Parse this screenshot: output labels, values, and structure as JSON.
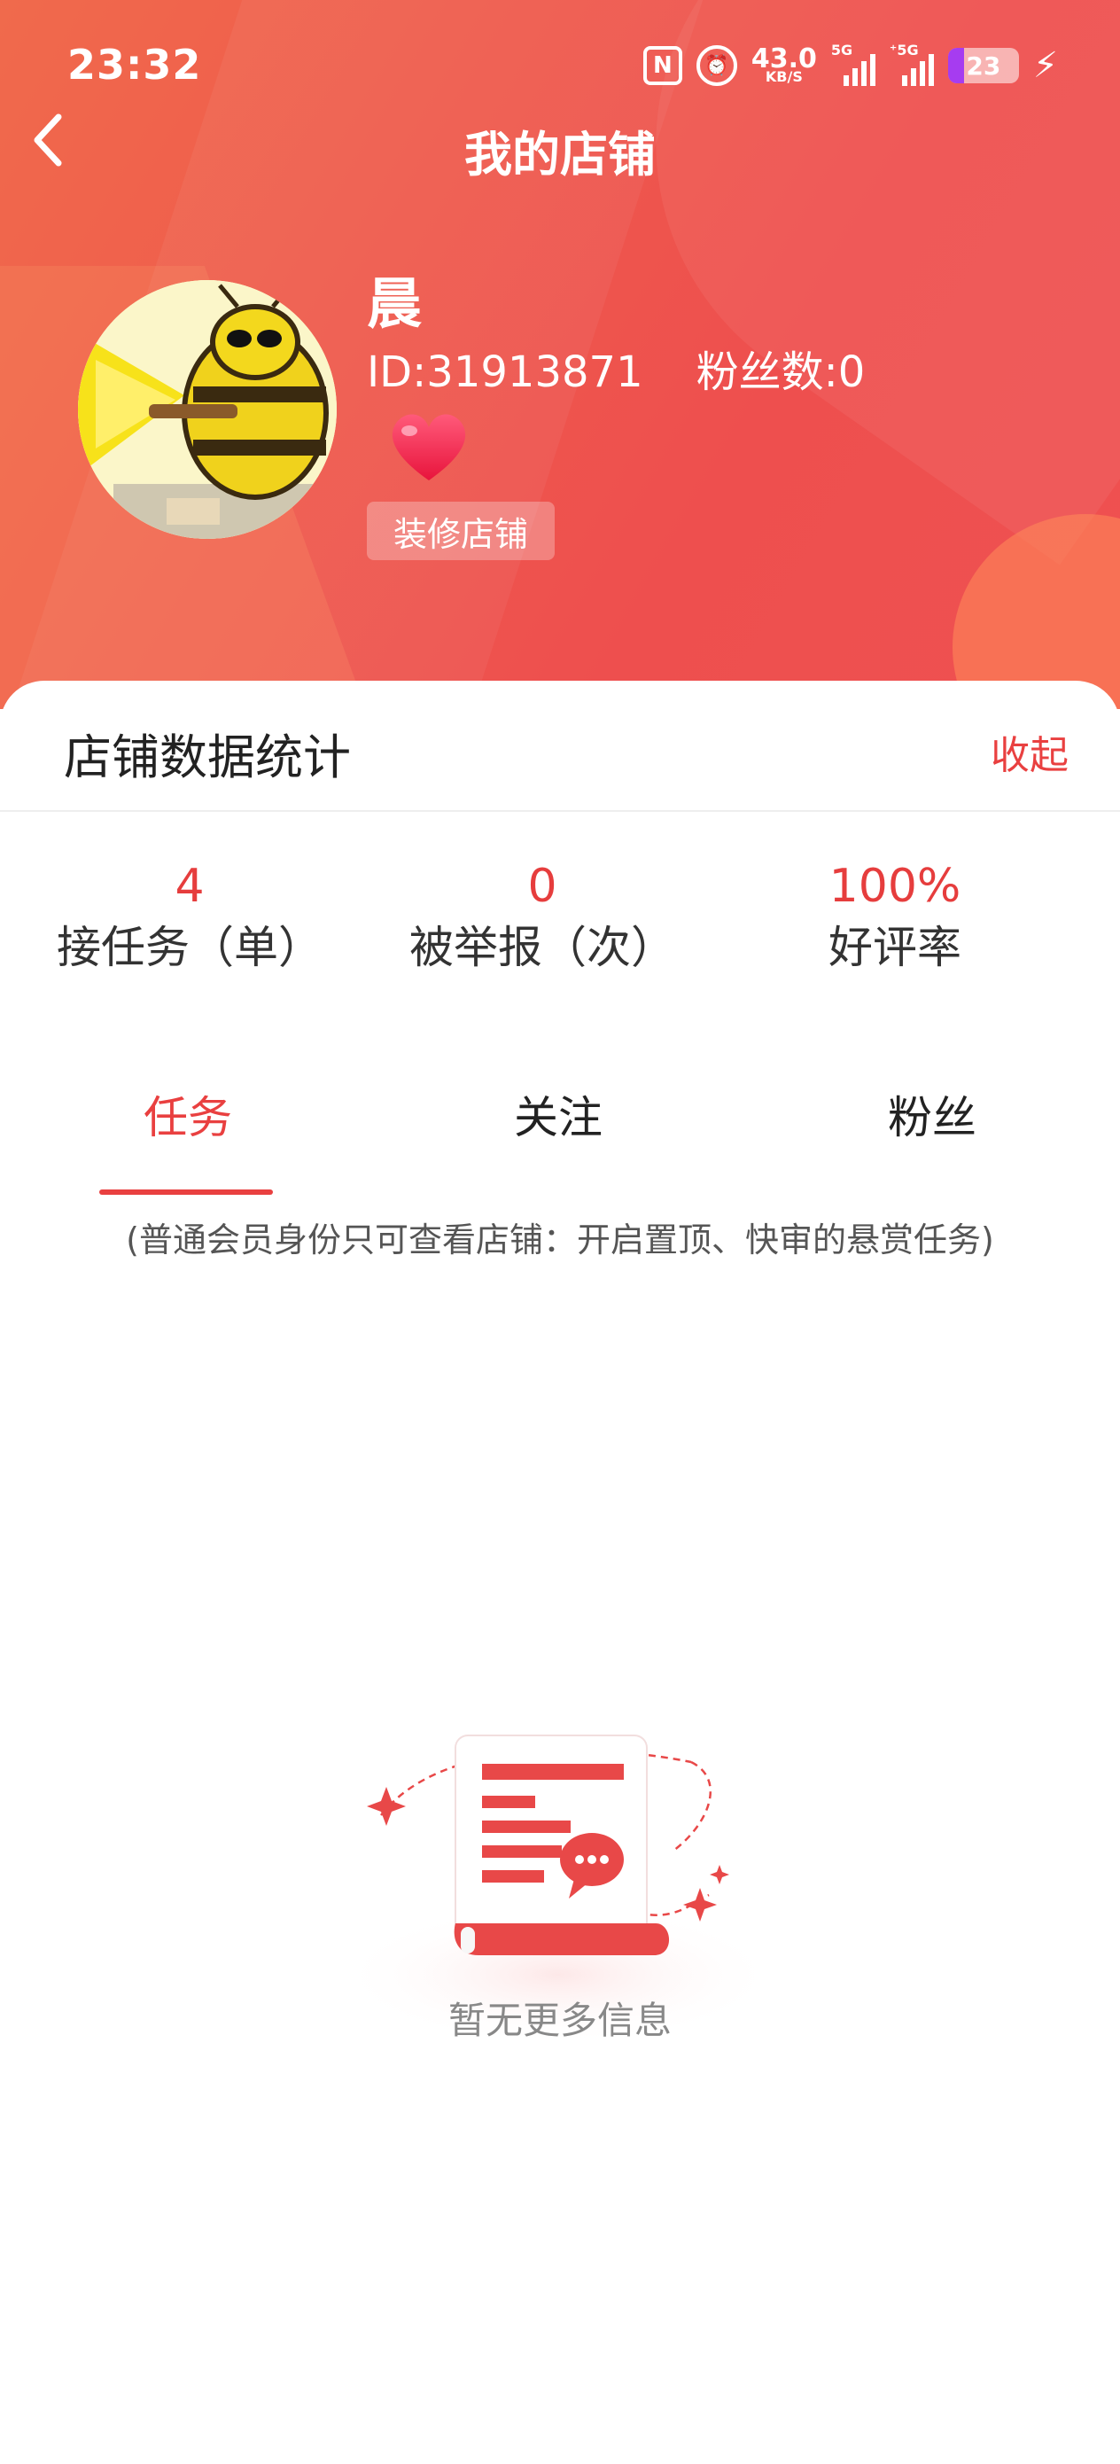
{
  "status_bar": {
    "time": "23:32",
    "nfc_icon": "nfc-icon",
    "alarm_icon": "alarm-icon",
    "net_speed_value": "43.0",
    "net_speed_unit": "KB/S",
    "signal1_label": "5G",
    "signal2_label": "⁺5G",
    "battery_level": "23",
    "battery_fraction": 0.23
  },
  "nav": {
    "title": "我的店铺",
    "back_icon": "back-arrow-icon"
  },
  "profile": {
    "name": "晨",
    "id_text": "ID:31913871",
    "fans_text": "粉丝数:0",
    "badge_icon": "heart-icon",
    "decorate_label": "装修店铺"
  },
  "stats": {
    "title": "店铺数据统计",
    "collapse_label": "收起",
    "items": [
      {
        "value": "4",
        "label": "接任务（单）"
      },
      {
        "value": "0",
        "label": "被举报（次）"
      },
      {
        "value": "100%",
        "label": "好评率"
      }
    ]
  },
  "tabs": [
    {
      "label": "任务",
      "active": true
    },
    {
      "label": "关注",
      "active": false
    },
    {
      "label": "粉丝",
      "active": false
    }
  ],
  "notice": "(普通会员身份只可查看店铺：开启置顶、快审的悬赏任务)",
  "empty": {
    "icon": "empty-document-icon",
    "text": "暂无更多信息"
  },
  "colors": {
    "accent": "#e94040",
    "header_start": "#f06a4c",
    "header_end": "#ef5151"
  }
}
